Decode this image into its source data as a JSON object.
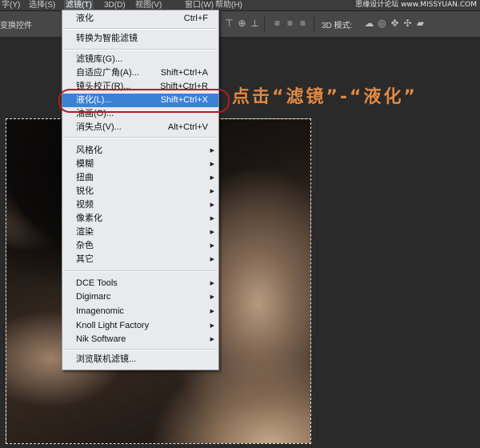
{
  "menubar": {
    "items": [
      {
        "label": "字(Y)",
        "active": false
      },
      {
        "label": "选择(S)",
        "active": false
      },
      {
        "label": "滤镜(T)",
        "active": true
      },
      {
        "label": "3D(D)",
        "active": false
      },
      {
        "label": "视图(V)",
        "active": false
      },
      {
        "label": "窗口(W)",
        "active": false
      },
      {
        "label": "帮助(H)",
        "active": false
      }
    ],
    "watermark": "思缘设计论坛 www.MISSYUAN.COM"
  },
  "options": {
    "left_label": "变换控件",
    "mode_label": "3D 模式:"
  },
  "filter_menu": {
    "sections": [
      [
        {
          "label": "液化",
          "shortcut": "Ctrl+F"
        }
      ],
      [
        {
          "label": "转换为智能滤镜",
          "shortcut": ""
        }
      ],
      [
        {
          "label": "滤镜库(G)...",
          "shortcut": ""
        },
        {
          "label": "自适应广角(A)...",
          "shortcut": "Shift+Ctrl+A"
        },
        {
          "label": "镜头校正(R)...",
          "shortcut": "Shift+Ctrl+R"
        },
        {
          "label": "液化(L)...",
          "shortcut": "Shift+Ctrl+X",
          "highlighted": true
        },
        {
          "label": "油画(O)...",
          "shortcut": ""
        },
        {
          "label": "消失点(V)...",
          "shortcut": "Alt+Ctrl+V"
        }
      ],
      [
        {
          "label": "风格化",
          "submenu": true
        },
        {
          "label": "模糊",
          "submenu": true
        },
        {
          "label": "扭曲",
          "submenu": true
        },
        {
          "label": "锐化",
          "submenu": true
        },
        {
          "label": "视频",
          "submenu": true
        },
        {
          "label": "像素化",
          "submenu": true
        },
        {
          "label": "渲染",
          "submenu": true
        },
        {
          "label": "杂色",
          "submenu": true
        },
        {
          "label": "其它",
          "submenu": true
        }
      ],
      [
        {
          "label": "DCE Tools",
          "submenu": true
        },
        {
          "label": "Digimarc",
          "submenu": true
        },
        {
          "label": "Imagenomic",
          "submenu": true
        },
        {
          "label": "Knoll Light Factory",
          "submenu": true
        },
        {
          "label": "Nik Software",
          "submenu": true
        }
      ],
      [
        {
          "label": "浏览联机滤镜...",
          "shortcut": ""
        }
      ]
    ]
  },
  "annotation": {
    "callout": "点击“滤镜”-“液化”",
    "ring_color": "#b31d1d",
    "callout_color": "#e08a45"
  },
  "colors": {
    "menu_highlight": "#3b81d6",
    "menu_bg": "#e9eaed",
    "app_bg": "#2f2f2f"
  }
}
